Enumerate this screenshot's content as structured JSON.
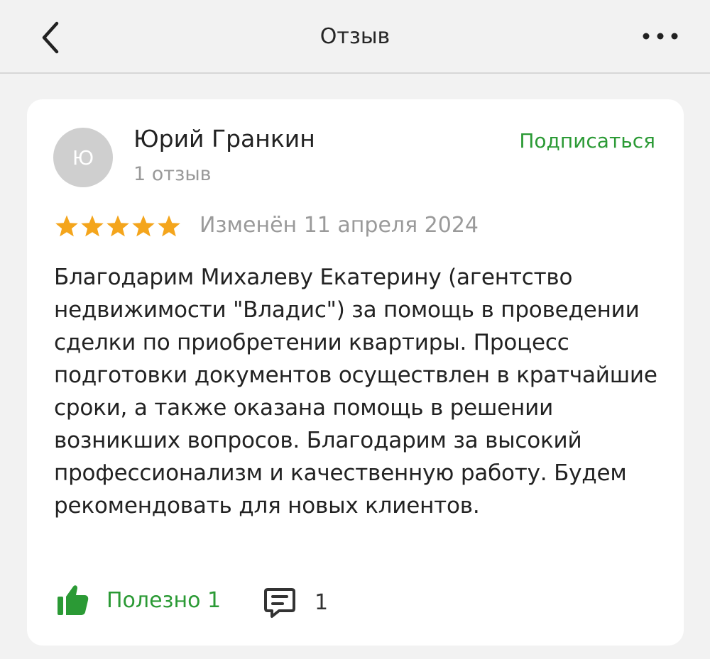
{
  "header": {
    "title": "Отзыв",
    "back_icon": "chevron-left-icon",
    "more_icon": "more-horizontal-icon"
  },
  "author": {
    "avatar_letter": "Ю",
    "name": "Юрий Гранкин",
    "reviews_count": "1 отзыв",
    "subscribe_label": "Подписаться"
  },
  "review": {
    "rating": 5,
    "rating_max": 5,
    "modified": "Изменён 11 апреля 2024",
    "text": "Благодарим Михалеву Екатерину (агентство недвижимости \"Владис\") за помощь в проведении сделки по приобретении квартиры. Процесс подготовки документов осуществлен в кратчайшие сроки, а также оказана помощь в решении возникших вопросов. Благодарим за высокий профессионализм и качественную работу. Будем рекомендовать для новых клиентов."
  },
  "actions": {
    "helpful_label": "Полезно 1",
    "comments_count": "1"
  },
  "colors": {
    "accent_green": "#2b9a35",
    "star": "#f4a51c",
    "muted": "#999999",
    "background": "#f2f2f2",
    "card": "#ffffff"
  }
}
